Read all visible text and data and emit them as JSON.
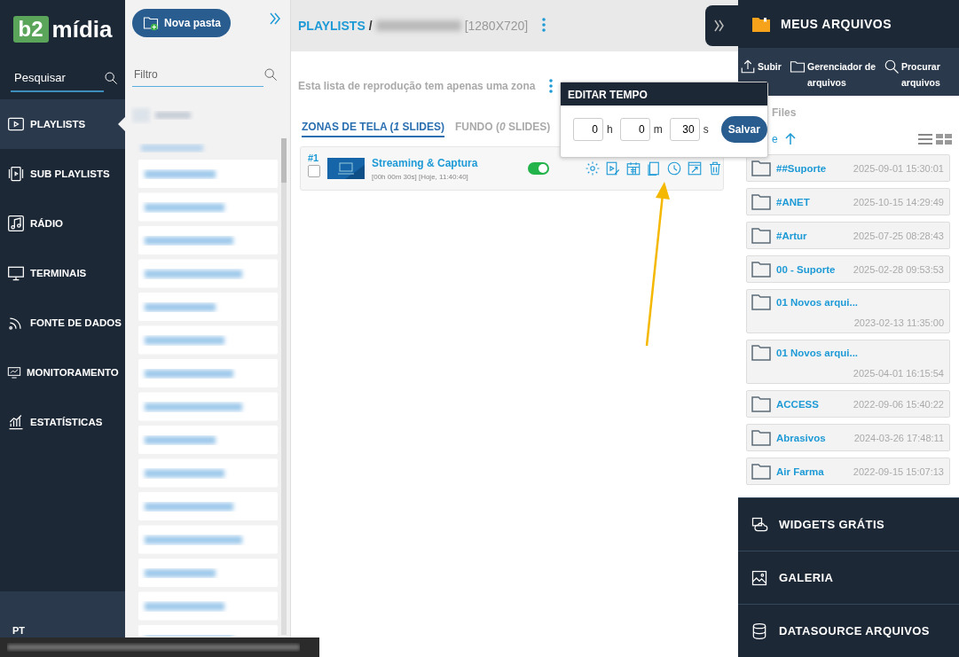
{
  "logo": {
    "mark": "b2",
    "name": "mídia"
  },
  "sidebar": {
    "search": {
      "placeholder": "Pesquisar"
    },
    "items": [
      {
        "label": "PLAYLISTS",
        "selected": true
      },
      {
        "label": "SUB PLAYLISTS",
        "selected": false
      },
      {
        "label": "RÁDIO",
        "selected": false
      },
      {
        "label": "TERMINAIS",
        "selected": false
      },
      {
        "label": "FONTE DE DADOS",
        "selected": false
      },
      {
        "label": "MONITORAMENTO",
        "selected": false
      },
      {
        "label": "ESTATÍSTICAS",
        "selected": false
      }
    ],
    "language": "PT"
  },
  "folders": {
    "new_folder_button": "Nova pasta",
    "filter": {
      "placeholder": "Filtro"
    }
  },
  "main": {
    "breadcrumb": {
      "root": "PLAYLISTS",
      "separator": "/",
      "resolution": "[1280X720]"
    },
    "note": "Esta lista de reprodução tem apenas uma zona",
    "tabs": [
      {
        "label": "ZONAS DE TELA (*1* SLIDES)",
        "selected": true
      },
      {
        "label": "FUNDO (*0* SLIDES)",
        "selected": false
      }
    ],
    "slides": [
      {
        "number": "#1",
        "title": "Streaming & Captura",
        "meta": "[00h 00m 30s] [Hoje, 11:40:40]",
        "checked": false,
        "on": true
      }
    ]
  },
  "edit_time": {
    "title": "EDITAR TEMPO",
    "fields": [
      {
        "value": "0",
        "unit": "h"
      },
      {
        "value": "0",
        "unit": "m"
      },
      {
        "value": "30",
        "unit": "s"
      }
    ],
    "button": "Salvar"
  },
  "files": {
    "title": "MEUS ARQUIVOS",
    "actions": [
      "Subir",
      "Gerenciador de arquivos",
      "Procurar arquivos"
    ],
    "section": "Files",
    "sort": "e",
    "items": [
      {
        "name": "##Suporte",
        "date": "2025-09-01 15:30:01"
      },
      {
        "name": "#ANET",
        "date": "2025-10-15 14:29:49"
      },
      {
        "name": "#Artur",
        "date": "2025-07-25 08:28:43"
      },
      {
        "name": "00 - Suporte",
        "date": "2025-02-28 09:53:53"
      },
      {
        "name": "01 Novos arqui...",
        "date": "2023-02-13 11:35:00"
      },
      {
        "name": "01 Novos arqui...",
        "date": "2025-04-01 16:15:54"
      },
      {
        "name": "ACCESS",
        "date": "2022-09-06 15:40:22"
      },
      {
        "name": "Abrasivos",
        "date": "2024-03-26 17:48:11"
      },
      {
        "name": "Air Farma",
        "date": "2022-09-15 15:07:13"
      }
    ],
    "footer": [
      "WIDGETS GRÁTIS",
      "GALERIA",
      "DATASOURCE ARQUIVOS"
    ]
  }
}
